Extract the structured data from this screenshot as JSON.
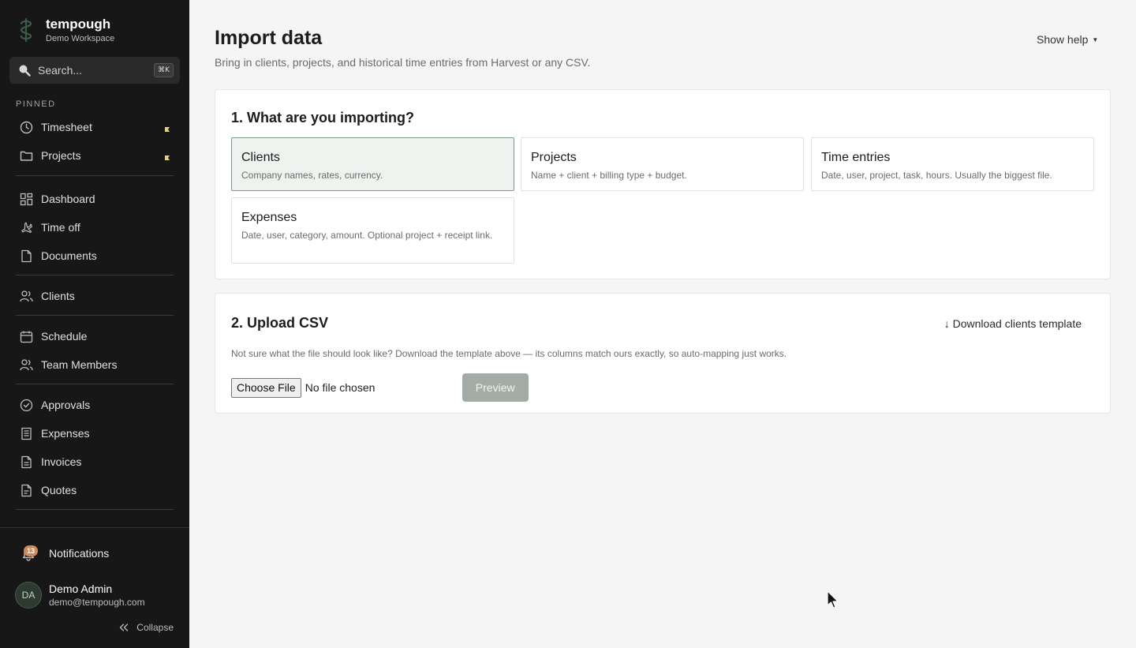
{
  "sidebar": {
    "brand": {
      "name": "tempough",
      "workspace": "Demo Workspace"
    },
    "search": {
      "placeholder": "Search...",
      "shortcut": "⌘K"
    },
    "pinned_label": "PINNED",
    "pinned": [
      {
        "label": "Timesheet",
        "icon": "clock-icon"
      },
      {
        "label": "Projects",
        "icon": "folder-icon"
      }
    ],
    "items": [
      {
        "label": "Dashboard",
        "icon": "grid-icon"
      },
      {
        "label": "Time off",
        "icon": "plane-icon"
      },
      {
        "label": "Documents",
        "icon": "document-icon"
      },
      {
        "label": "Clients",
        "icon": "users-icon"
      },
      {
        "label": "Schedule",
        "icon": "calendar-icon"
      },
      {
        "label": "Team Members",
        "icon": "users-icon"
      },
      {
        "label": "Approvals",
        "icon": "check-circle-icon"
      },
      {
        "label": "Expenses",
        "icon": "receipt-icon"
      },
      {
        "label": "Invoices",
        "icon": "invoice-icon"
      },
      {
        "label": "Quotes",
        "icon": "quote-icon"
      }
    ],
    "notifications": {
      "label": "Notifications",
      "count": "13"
    },
    "user": {
      "initials": "DA",
      "name": "Demo Admin",
      "email": "demo@tempough.com"
    },
    "collapse_label": "Collapse"
  },
  "main": {
    "title": "Import data",
    "subtitle": "Bring in clients, projects, and historical time entries from Harvest or any CSV.",
    "show_help": "Show help",
    "step1": {
      "title": "1. What are you importing?",
      "options": [
        {
          "title": "Clients",
          "desc": "Company names, rates, currency.",
          "selected": true
        },
        {
          "title": "Projects",
          "desc": "Name + client + billing type + budget.",
          "selected": false
        },
        {
          "title": "Time entries",
          "desc": "Date, user, project, task, hours. Usually the biggest file.",
          "selected": false
        },
        {
          "title": "Expenses",
          "desc": "Date, user, category, amount. Optional project + receipt link.",
          "selected": false
        }
      ]
    },
    "step2": {
      "title": "2. Upload CSV",
      "download_link": "↓ Download clients template",
      "help": "Not sure what the file should look like? Download the template above — its columns match ours exactly, so auto-mapping just works.",
      "choose_file": "Choose File",
      "no_file": "No file chosen",
      "preview": "Preview"
    }
  },
  "colors": {
    "sidebar_bg": "#171717",
    "selected_option_bg": "#eef3ef",
    "selected_option_border": "#7d9a84",
    "preview_disabled": "#a3aca5",
    "badge": "#d08a5a"
  }
}
